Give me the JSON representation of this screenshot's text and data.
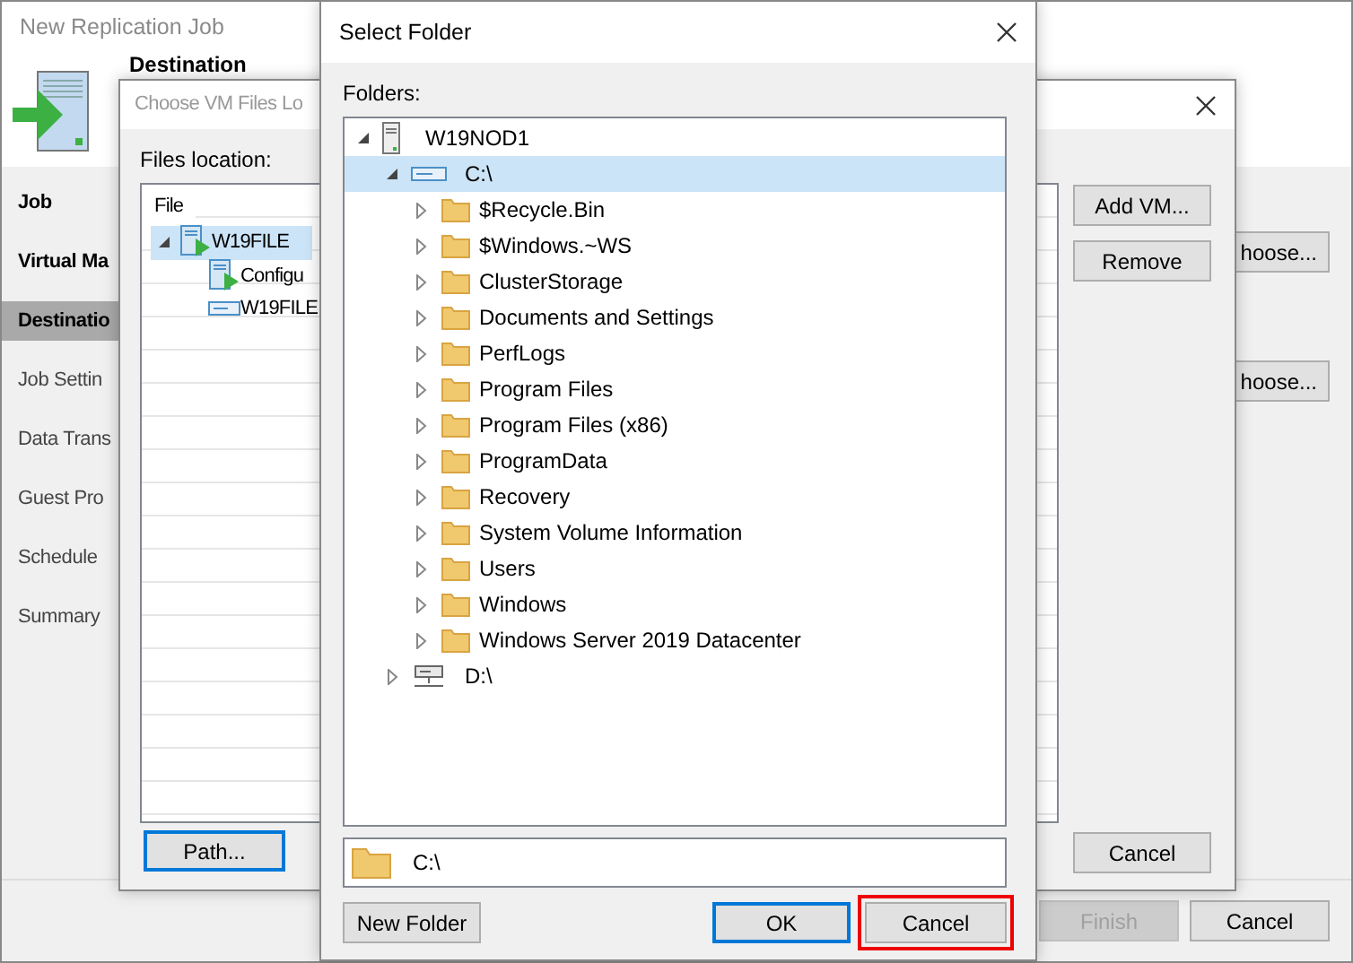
{
  "main_window": {
    "title": "New Replication Job",
    "header": "Destination",
    "steps": [
      {
        "label": "Job",
        "selected": false
      },
      {
        "label": "Virtual Ma",
        "selected": false
      },
      {
        "label": "Destinatio",
        "selected": true
      },
      {
        "label": "Job Settin",
        "selected": false
      },
      {
        "label": "Data Trans",
        "selected": false
      },
      {
        "label": "Guest Pro",
        "selected": false
      },
      {
        "label": "Schedule",
        "selected": false
      },
      {
        "label": "Summary",
        "selected": false
      }
    ],
    "side_buttons": [
      "hoose...",
      "hoose..."
    ],
    "footer_buttons": [
      {
        "label": "Finish",
        "disabled": true
      },
      {
        "label": "Cancel",
        "disabled": false
      }
    ]
  },
  "files_dialog": {
    "title": "Choose VM Files Lo",
    "location_label": "Files location:",
    "column": "File",
    "rows": [
      {
        "label": "W19FILE",
        "kind": "vm",
        "selected": true,
        "expanded": true,
        "children": [
          {
            "label": "Configu",
            "kind": "config",
            "selected": false
          },
          {
            "label": "W19FILE",
            "kind": "disk",
            "selected": false
          }
        ]
      }
    ],
    "side_buttons": [
      "Add VM...",
      "Remove"
    ],
    "path_button": "Path...",
    "cancel_button": "Cancel"
  },
  "select_folder": {
    "title": "Select Folder",
    "folders_label": "Folders:",
    "tree": [
      {
        "label": "W19NOD1",
        "kind": "server",
        "expanded": true,
        "selected": false,
        "children": [
          {
            "label": "C:\\",
            "kind": "drive",
            "expanded": true,
            "selected": true,
            "children": [
              {
                "label": "$Recycle.Bin",
                "kind": "folder",
                "expanded": false,
                "selected": false
              },
              {
                "label": "$Windows.~WS",
                "kind": "folder",
                "expanded": false,
                "selected": false
              },
              {
                "label": "ClusterStorage",
                "kind": "folder",
                "expanded": false,
                "selected": false
              },
              {
                "label": "Documents and Settings",
                "kind": "folder",
                "expanded": false,
                "selected": false
              },
              {
                "label": "PerfLogs",
                "kind": "folder",
                "expanded": false,
                "selected": false
              },
              {
                "label": "Program Files",
                "kind": "folder",
                "expanded": false,
                "selected": false
              },
              {
                "label": "Program Files (x86)",
                "kind": "folder",
                "expanded": false,
                "selected": false
              },
              {
                "label": "ProgramData",
                "kind": "folder",
                "expanded": false,
                "selected": false
              },
              {
                "label": "Recovery",
                "kind": "folder",
                "expanded": false,
                "selected": false
              },
              {
                "label": "System Volume Information",
                "kind": "folder",
                "expanded": false,
                "selected": false
              },
              {
                "label": "Users",
                "kind": "folder",
                "expanded": false,
                "selected": false
              },
              {
                "label": "Windows",
                "kind": "folder",
                "expanded": false,
                "selected": false
              },
              {
                "label": "Windows Server 2019 Datacenter",
                "kind": "folder",
                "expanded": false,
                "selected": false
              }
            ]
          },
          {
            "label": "D:\\",
            "kind": "shared-drive",
            "expanded": false,
            "selected": false
          }
        ]
      }
    ],
    "path_value": "C:\\",
    "buttons": [
      {
        "label": "New Folder",
        "default": false,
        "highlighted": false
      },
      {
        "label": "OK",
        "default": true,
        "highlighted": false
      },
      {
        "label": "Cancel",
        "default": false,
        "highlighted": true
      }
    ]
  }
}
